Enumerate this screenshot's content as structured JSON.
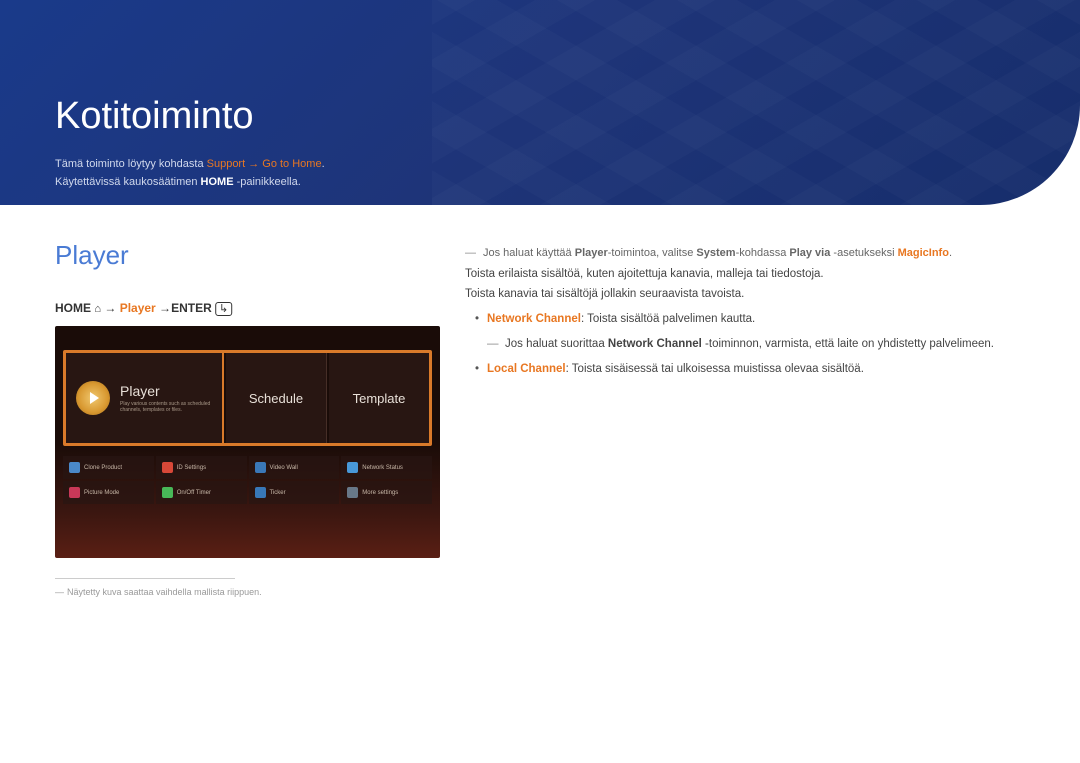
{
  "banner": {
    "title": "Kotitoiminto",
    "line1_pre": "Tämä toiminto löytyy kohdasta ",
    "line1_hl": "Support → Go to Home",
    "line2_pre": "Käytettävissä kaukosäätimen ",
    "line2_b": "HOME",
    "line2_post": " -painikkeella."
  },
  "player": {
    "heading": "Player",
    "path": {
      "home": "HOME",
      "arrow": " → ",
      "mid": "Player",
      "arrow2": " →",
      "enter": "ENTER"
    },
    "tiles": {
      "player_title": "Player",
      "player_sub": "Play various contents such as scheduled channels, templates or files.",
      "schedule": "Schedule",
      "template": "Template"
    },
    "buttons": [
      "Clone Product",
      "ID Settings",
      "Video Wall",
      "Network Status",
      "Picture Mode",
      "On/Off Timer",
      "Ticker",
      "More settings"
    ],
    "footnote": "Näytetty kuva saattaa vaihdella mallista riippuen."
  },
  "right": {
    "note1_pre": "Jos haluat käyttää ",
    "note1_b1": "Player",
    "note1_mid1": "-toimintoa, valitse ",
    "note1_b2": "System",
    "note1_mid2": "-kohdassa ",
    "note1_b3": "Play via",
    "note1_mid3": " -asetukseksi ",
    "note1_b4": "MagicInfo",
    "note1_end": ".",
    "p1": "Toista erilaista sisältöä, kuten ajoitettuja kanavia, malleja tai tiedostoja.",
    "p2": "Toista kanavia tai sisältöjä jollakin seuraavista tavoista.",
    "li1_b": "Network Channel",
    "li1_t": ": Toista sisältöä palvelimen kautta.",
    "li1_sub_pre": "Jos haluat suorittaa ",
    "li1_sub_b": "Network Channel",
    "li1_sub_post": " -toiminnon, varmista, että laite on yhdistetty palvelimeen.",
    "li2_b": "Local Channel",
    "li2_t": ": Toista sisäisessä tai ulkoisessa muistissa olevaa sisältöä."
  }
}
